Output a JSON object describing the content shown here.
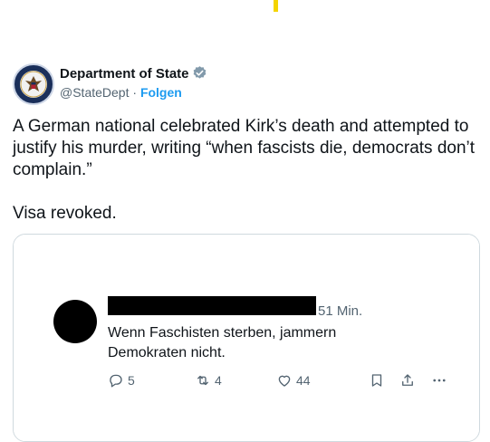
{
  "account": {
    "name": "Department of State",
    "handle": "@StateDept",
    "separator": "·",
    "follow_label": "Folgen"
  },
  "tweet": {
    "line1": "A German national celebrated Kirk’s death and attempted to justify his murder, writing “when fascists die, democrats don’t complain.”",
    "line2": "Visa revoked."
  },
  "embedded": {
    "time": "51 Min.",
    "text": "Wenn Faschisten sterben, jammern Demokraten nicht.",
    "replies": "5",
    "reposts": "4",
    "likes": "44"
  },
  "colors": {
    "accent": "#1d9bf0",
    "muted": "#536471",
    "border": "#cfd9de",
    "mark": "#f4d400"
  },
  "icons": [
    "seal-icon",
    "verified-badge-icon",
    "reply-icon",
    "repost-icon",
    "like-icon",
    "bookmark-icon",
    "share-icon",
    "more-icon"
  ]
}
